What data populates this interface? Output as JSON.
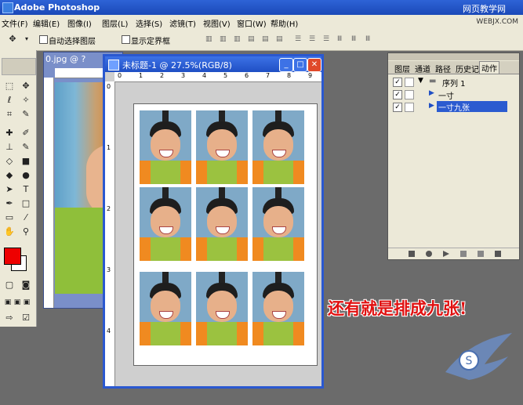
{
  "app": {
    "title": "Adobe Photoshop"
  },
  "watermarks": {
    "top": "网页教学网",
    "top_url": "WEBJX.COM"
  },
  "menu": [
    "文件(F)",
    "编辑(E)",
    "图像(I)",
    "图层(L)",
    "选择(S)",
    "滤镜(T)",
    "视图(V)",
    "窗口(W)",
    "帮助(H)"
  ],
  "options": {
    "auto_select": "自动选择图层",
    "show_bounds": "显示定界框"
  },
  "doc1": {
    "title": "0.jpg @ ?"
  },
  "doc2": {
    "title": "未标题-1 @ 27.5%(RGB/8)",
    "ruler_h": [
      "0",
      "1",
      "2",
      "3",
      "4",
      "5",
      "6",
      "7",
      "8",
      "9"
    ],
    "ruler_v": [
      "0",
      "1",
      "2",
      "3",
      "4"
    ]
  },
  "panel": {
    "tabs": [
      "图层",
      "通道",
      "路径",
      "历史记",
      "动作"
    ],
    "rows": [
      {
        "label": "序列 1"
      },
      {
        "label": "一寸"
      },
      {
        "label": "一寸九张"
      }
    ]
  },
  "caption": "还有就是排成九张!",
  "colors": {
    "foreground": "#e00000",
    "background": "#ffffff",
    "title_blue": "#1f4fc4"
  }
}
